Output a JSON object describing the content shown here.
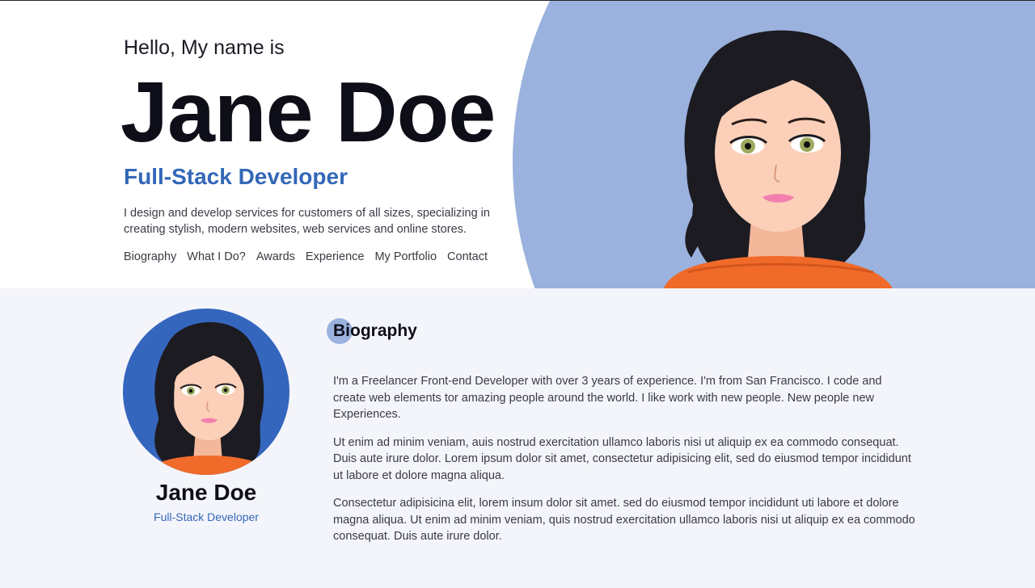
{
  "hero": {
    "greeting": "Hello, My name is",
    "name": "Jane Doe",
    "role": "Full-Stack Developer",
    "description": "I design and develop services for customers of all sizes, specializing in creating stylish, modern websites, web services and online stores.",
    "nav": [
      "Biography",
      "What I Do?",
      "Awards",
      "Experience",
      "My Portfolio",
      "Contact"
    ]
  },
  "profile": {
    "name": "Jane Doe",
    "role": "Full-Stack Developer"
  },
  "biography": {
    "title": "Biography",
    "paragraphs": [
      "I'm a Freelancer Front-end Developer with over 3 years of experience. I'm from San Francisco. I code and create web elements tor amazing people around the world. I like work with new people. New people new Experiences.",
      "Ut enim ad minim veniam, auis nostrud exercitation ullamco laboris nisi ut aliquip ex ea commodo consequat. Duis aute irure dolor. Lorem ipsum dolor sit amet, consectetur adipisicing elit, sed do eiusmod tempor incididunt ut labore et dolore magna aliqua.",
      "Consectetur adipisicina elit, lorem insum dolor sit amet. sed do eiusmod tempor incididunt uti labore et dolore magna aliqua. Ut enim ad minim veniam, quis nostrud exercitation ullamco laboris nisi ut aliquip ex ea commodo consequat. Duis aute irure dolor."
    ]
  },
  "colors": {
    "accent": "#3367b8",
    "hero_circle": "#9ab2dd",
    "avatar_bg": "#3566bd",
    "shirt": "#f06a2a"
  }
}
